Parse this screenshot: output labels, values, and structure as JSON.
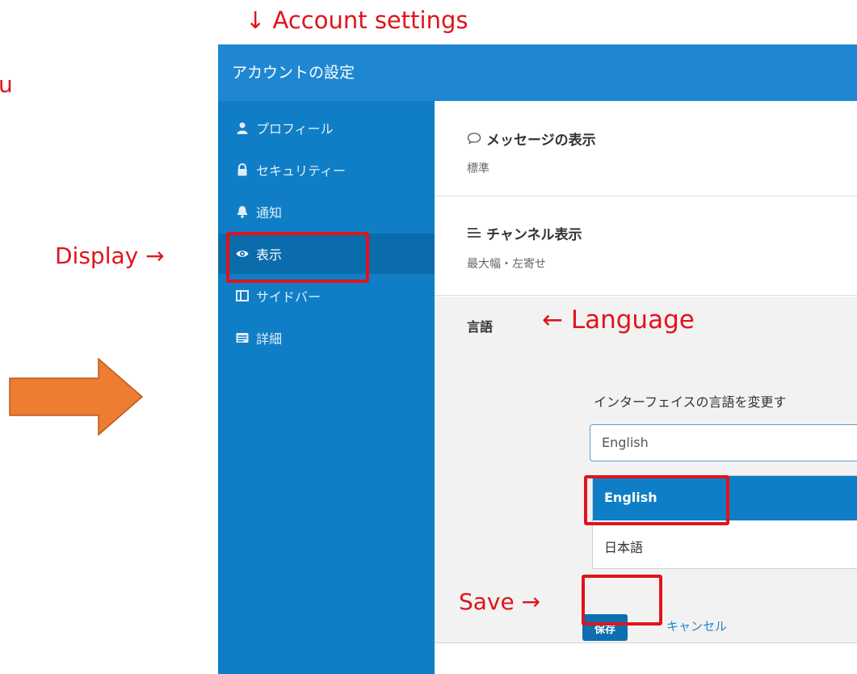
{
  "annotations": {
    "account_settings": "↓ Account settings",
    "left_cut": "u",
    "display": "Display →",
    "language": "← Language",
    "save": "Save →"
  },
  "window": {
    "title": "アカウントの設定"
  },
  "sidebar": {
    "items": [
      {
        "label": "プロフィール",
        "icon": "user-icon"
      },
      {
        "label": "セキュリティー",
        "icon": "lock-icon"
      },
      {
        "label": "通知",
        "icon": "bell-icon"
      },
      {
        "label": "表示",
        "icon": "eye-icon",
        "active": true
      },
      {
        "label": "サイドバー",
        "icon": "columns-icon"
      },
      {
        "label": "詳細",
        "icon": "card-icon"
      }
    ]
  },
  "content": {
    "message_display": {
      "title": "メッセージの表示",
      "value": "標準",
      "icon": "speech-bubble-icon"
    },
    "channel_display": {
      "title": "チャンネル表示",
      "value": "最大幅・左寄せ",
      "icon": "align-left-icon"
    },
    "language": {
      "title": "言語",
      "description": "インターフェイスの言語を変更す",
      "input_value": "English",
      "options": [
        "English",
        "日本語"
      ],
      "selected": "English",
      "save_label": "保存",
      "cancel_label": "キャンセル"
    }
  },
  "colors": {
    "accent": "#1f87d1",
    "sidebar_bg": "#0f7ec6",
    "sidebar_active": "#0a6cab",
    "annotation_red": "#e0141b",
    "arrow_orange": "#ed7d31"
  }
}
